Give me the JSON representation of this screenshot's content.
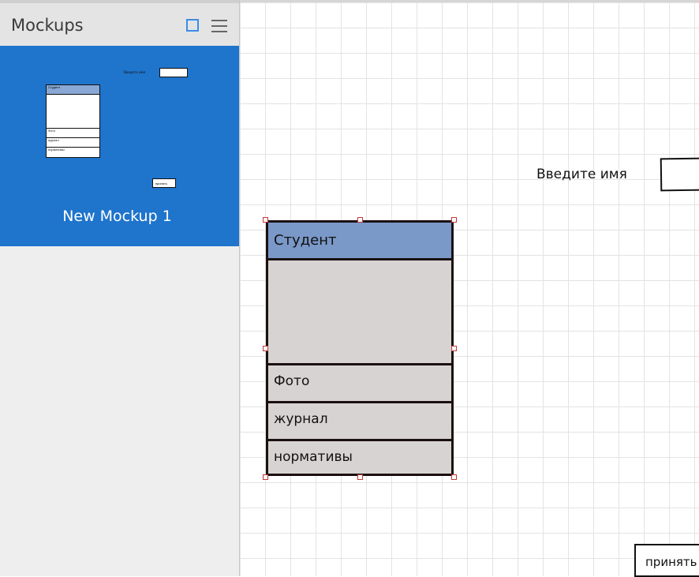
{
  "panel": {
    "title": "Mockups",
    "grid_view_icon": "square-icon",
    "list_view_icon": "menu-icon"
  },
  "mockups": [
    {
      "name": "New Mockup 1",
      "selected": true
    }
  ],
  "thumbnail": {
    "name_label": "Введите имя",
    "list_header": "Студент",
    "list_items": [
      "Фото",
      "журнал",
      "нормативы"
    ],
    "button_label": "принять"
  },
  "canvas": {
    "name_label": "Введите имя",
    "name_input_value": "",
    "list": {
      "header": "Студент",
      "items": [
        "Фото",
        "журнал",
        "нормативы"
      ]
    },
    "accept_button": "принять"
  },
  "colors": {
    "selection": "#1f74cc",
    "list_header": "#7a98c8",
    "list_body": "#d8d3d3",
    "handle_border": "#c03a3a"
  }
}
